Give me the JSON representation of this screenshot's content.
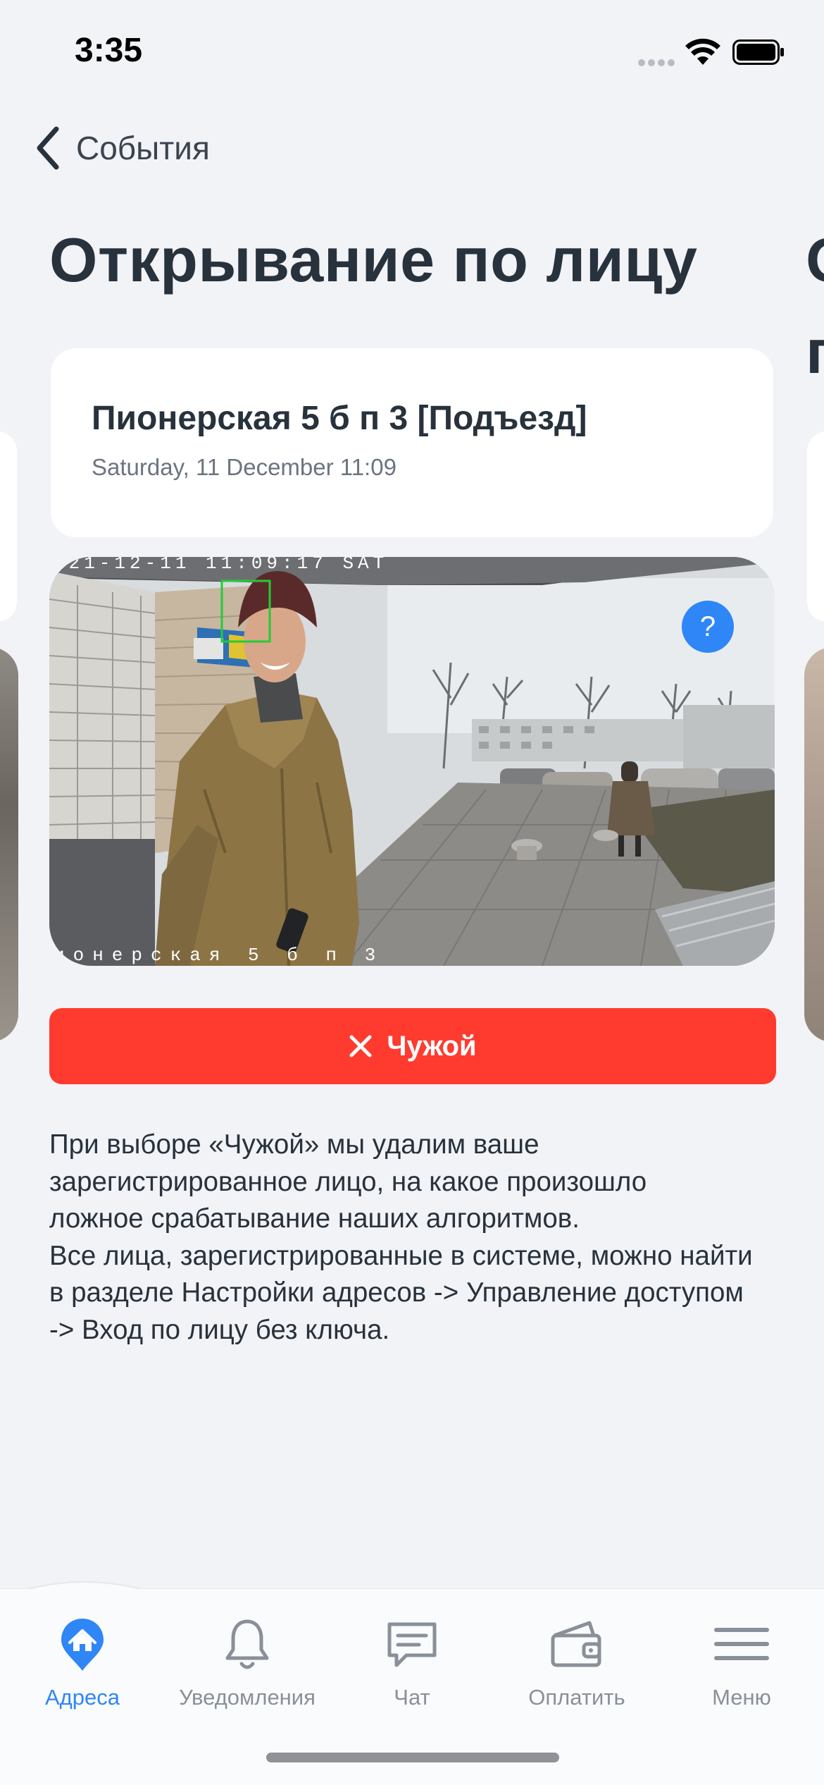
{
  "status_bar": {
    "time": "3:35"
  },
  "nav": {
    "back_label": "События",
    "back_icon": "chevron-left-icon"
  },
  "page": {
    "title": "Открывание по лицу",
    "next_title_peek_line1": "О",
    "next_title_peek_line2": "п"
  },
  "event": {
    "address": "Пионерская 5 б п 3 [Подъезд]",
    "date": "Saturday, 11 December 11:09",
    "camera_timestamp": "021-12-11  11:09:17 SAT",
    "camera_label": "ионерская 5 б п 3",
    "help_label": "?"
  },
  "action": {
    "stranger_label": "Чужой",
    "stranger_icon": "close-icon",
    "stranger_color": "#FF3B30"
  },
  "description": {
    "line1": "При выборе «Чужой» мы удалим ваше",
    "line2": "зарегистрированное лицо, на какое произошло",
    "line3": "ложное срабатывание наших алгоритмов.",
    "line4": "Все лица, зарегистрированные в системе, можно найти",
    "line5": "в разделе Настройки адресов -> Управление доступом",
    "line6": "-> Вход по лицу без ключа."
  },
  "tabs": [
    {
      "label": "Адреса",
      "icon": "home-pin-icon",
      "active": true
    },
    {
      "label": "Уведомления",
      "icon": "bell-icon",
      "active": false
    },
    {
      "label": "Чат",
      "icon": "chat-icon",
      "active": false
    },
    {
      "label": "Оплатить",
      "icon": "wallet-icon",
      "active": false
    },
    {
      "label": "Меню",
      "icon": "menu-icon",
      "active": false
    }
  ],
  "colors": {
    "accent": "#2F86F6",
    "background": "#F2F3F7",
    "text": "#28323C",
    "inactive": "#8A9099"
  }
}
